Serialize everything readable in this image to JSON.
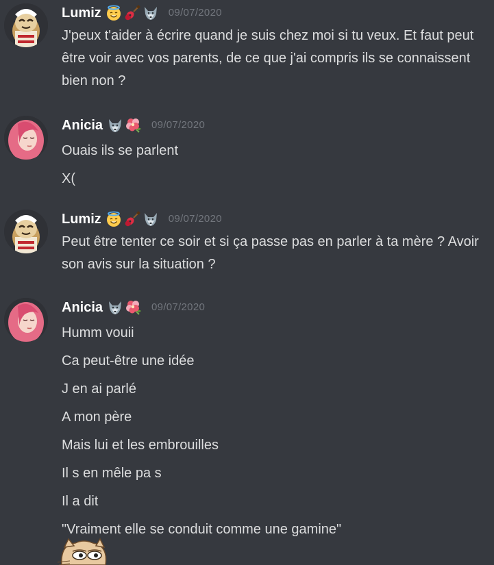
{
  "messages": [
    {
      "username": "Lumiz",
      "badges": [
        "angel-face-icon",
        "guitar-icon",
        "wolf-icon"
      ],
      "timestamp": "09/07/2020",
      "lines": [
        "J'peux t'aider à écrire quand je suis chez moi si tu veux. Et faut peut être voir avec vos parents, de ce que j'ai compris ils se connaissent bien non ?"
      ]
    },
    {
      "username": "Anicia",
      "badges": [
        "wolf-icon",
        "hibiscus-icon"
      ],
      "timestamp": "09/07/2020",
      "lines": [
        "Ouais ils se parlent",
        "X("
      ]
    },
    {
      "username": "Lumiz",
      "badges": [
        "angel-face-icon",
        "guitar-icon",
        "wolf-icon"
      ],
      "timestamp": "09/07/2020",
      "lines": [
        "Peut être tenter ce soir et si ça passe pas en parler à ta mère ? Avoir son avis sur la situation ?"
      ]
    },
    {
      "username": "Anicia",
      "badges": [
        "wolf-icon",
        "hibiscus-icon"
      ],
      "timestamp": "09/07/2020",
      "lines": [
        "Humm vouii",
        "Ca peut-être une idée",
        "J en ai parlé",
        "A mon père",
        "Mais lui et les embrouilles",
        "Il s en mêle pa s",
        "Il a dit",
        "\"Vraiment elle se conduit comme une gamine\""
      ]
    }
  ],
  "sticker": {
    "icon": "pepe-cat-sticker-icon"
  },
  "colors": {
    "background": "#36393f",
    "username": "#ffffff",
    "message_text": "#dcddde",
    "timestamp": "#72767d"
  }
}
